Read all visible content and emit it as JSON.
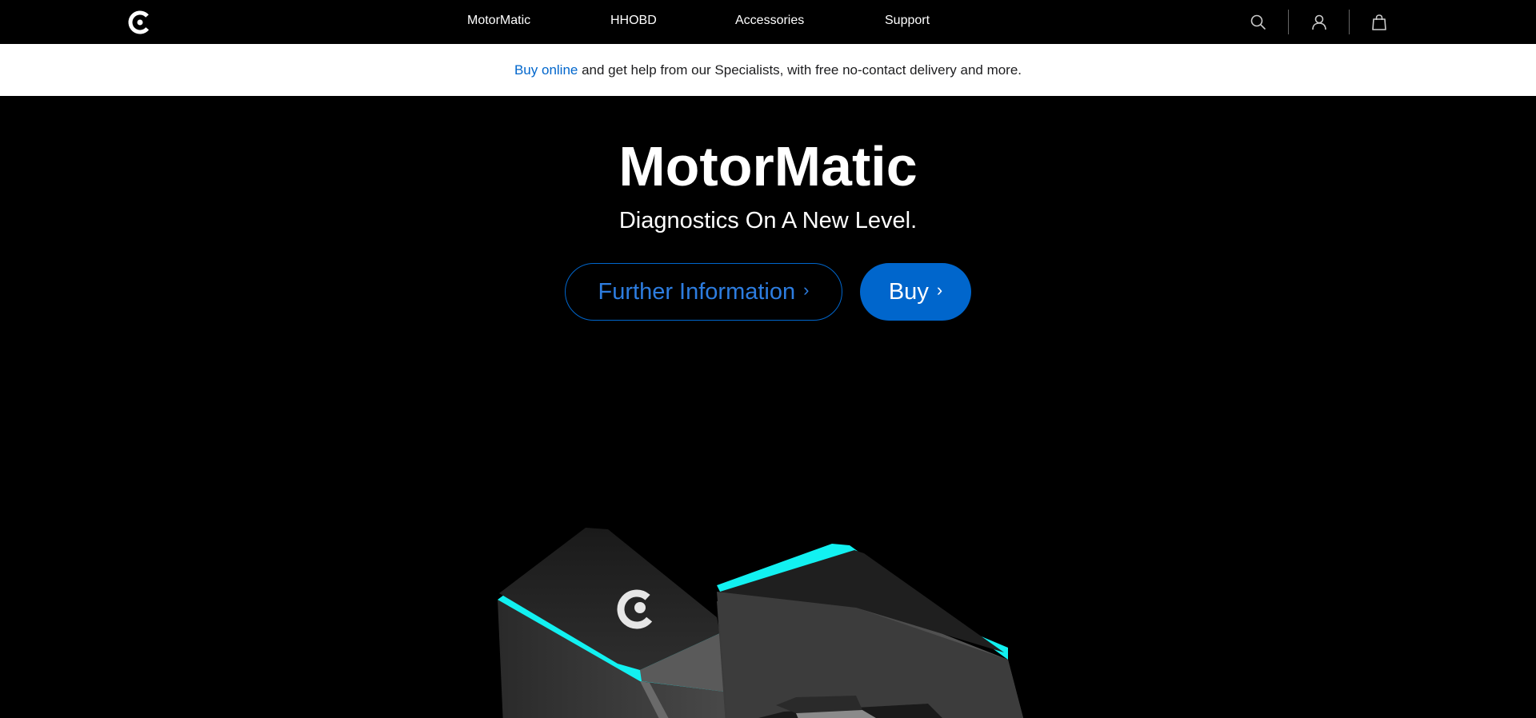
{
  "nav": {
    "logo_icon": "brand-logo-icon",
    "links": [
      "MotorMatic",
      "HHOBD",
      "Accessories",
      "Support"
    ],
    "icons": [
      "search-icon",
      "account-icon",
      "bag-icon"
    ]
  },
  "banner": {
    "link_text": "Buy online",
    "text": " and get help from our Specialists, with free no-contact delivery and more."
  },
  "hero": {
    "title": "MotorMatic",
    "subtitle": "Diagnostics On A New Level.",
    "info_button": "Further Information",
    "buy_button": "Buy",
    "chevron": "›",
    "image": "obd-device-product-image"
  },
  "colors": {
    "nav_bg": "#000000",
    "accent": "#0066cc",
    "glow": "#12f1f1"
  }
}
